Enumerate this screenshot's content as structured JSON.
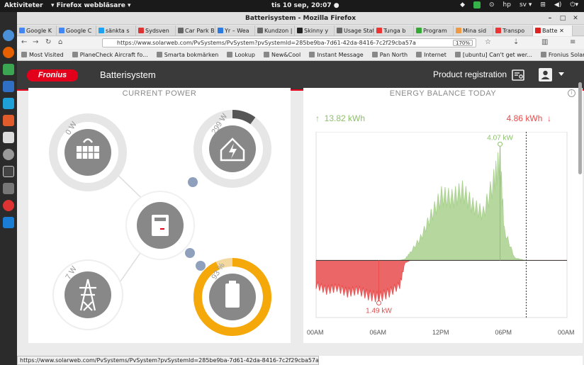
{
  "topbar": {
    "activities": "Aktiviteter",
    "app": "▾ Firefox webbläsare ▾",
    "clock": "tis 10 sep, 20:07 ●",
    "lang": "sv ▾"
  },
  "browser": {
    "window_title": "Batterisystem - Mozilla Firefox",
    "tabs": [
      "Google K",
      "Google C",
      "sänkta s",
      "Sydsven",
      "Car Park Bo",
      "Yr – Wea",
      "Kundzon |",
      "Skinny y",
      "Usage Stat",
      "Tunga b",
      "Program",
      "Mina sid",
      "Transpo",
      "Batte ✕"
    ],
    "url": "https://www.solarweb.com/PvSystems/PvSystem?pvSystemId=285be9ba-7d61-42da-8416-7c2f29cba57a",
    "zoom": "170%",
    "bookmarks": [
      "Most Visited",
      "PlaneCheck Aircraft fo...",
      "Smarta bokmärken",
      "Lookup",
      "New&Cool",
      "Instant Message",
      "Pan North",
      "Internet",
      "[ubuntu] Can't get wer...",
      "Fronius Solar.web"
    ],
    "status_url": "https://www.solarweb.com/PvSystems/PvSystem?pvSystemId=285be9ba-7d61-42da-8416-7c2f29cba57a"
  },
  "header": {
    "logo": "Fronius",
    "title": "Batterisystem",
    "product_registration": "Product registration"
  },
  "current_power": {
    "title": "CURRENT POWER",
    "pv_label": "0 W",
    "load_label": "299 W",
    "grid_label": "7 W",
    "battery_label": "93 %",
    "load_fraction": 0.25,
    "battery_soc": 0.93
  },
  "energy_balance": {
    "title": "ENERGY BALANCE TODAY",
    "produced": "13.82 kWh",
    "consumed": "4.86 kWh",
    "peak_label": "4.07 kW",
    "min_label": "1.49 kW",
    "x_labels": [
      "00AM",
      "06AM",
      "12PM",
      "06PM",
      "00AM"
    ]
  },
  "chart_data": {
    "type": "area",
    "title": "ENERGY BALANCE TODAY",
    "xlabel": "",
    "ylabel": "",
    "x_ticks": [
      "00AM",
      "06AM",
      "12PM",
      "06PM",
      "00AM"
    ],
    "x": [
      0,
      1,
      2,
      3,
      4,
      5,
      6,
      7,
      8,
      8.5,
      9,
      10,
      11,
      12,
      13,
      14,
      15,
      16,
      17,
      17.6,
      18,
      19,
      20,
      21,
      22,
      23,
      24
    ],
    "series": [
      {
        "name": "",
        "color": "#a9d18e",
        "values": [
          0,
          0,
          0,
          0,
          0,
          0,
          0,
          0,
          0,
          0.05,
          0.3,
          0.9,
          1.8,
          2.6,
          2.5,
          2.8,
          2.2,
          1.9,
          3.2,
          4.07,
          1.2,
          0.1,
          0,
          0,
          0,
          0,
          0
        ]
      },
      {
        "name": "",
        "color": "#e84c4c",
        "values": [
          -1.0,
          -1.2,
          -1.1,
          -1.3,
          -1.2,
          -1.4,
          -1.49,
          -1.3,
          -1.0,
          -0.1,
          0,
          0,
          0,
          0,
          0,
          0,
          0,
          0,
          0,
          0,
          0,
          0,
          0,
          0,
          0,
          0,
          0
        ]
      }
    ],
    "ylim": [
      -2.0,
      4.5
    ],
    "annotations": [
      {
        "label": "4.07 kW",
        "x": 17.6,
        "y": 4.07
      },
      {
        "label": "1.49 kW",
        "x": 6.0,
        "y": -1.49
      }
    ]
  }
}
